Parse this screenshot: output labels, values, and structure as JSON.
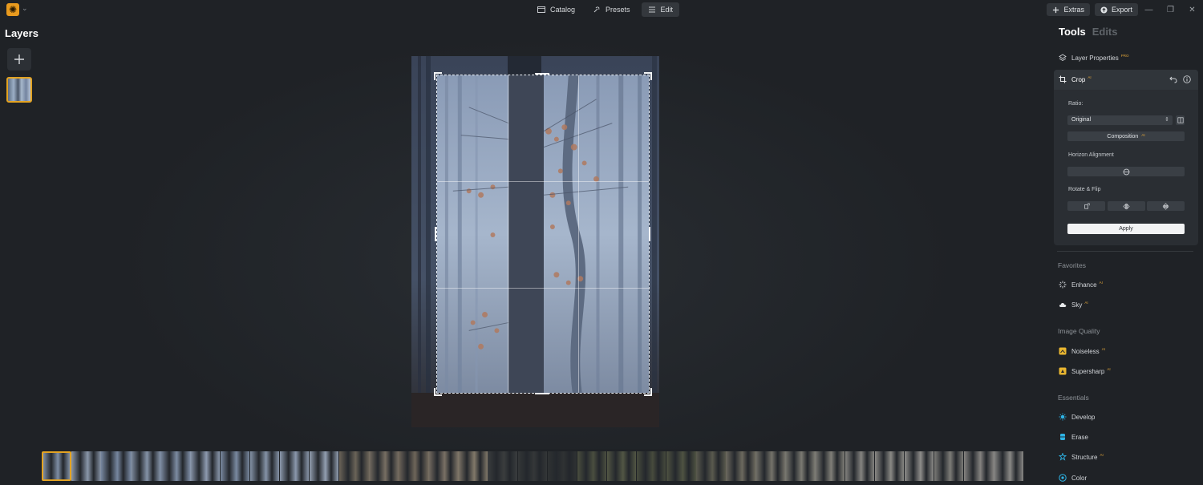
{
  "topbar": {
    "tabs": [
      {
        "label": "Catalog",
        "icon": "folder-icon"
      },
      {
        "label": "Presets",
        "icon": "sparkle-icon"
      },
      {
        "label": "Edit",
        "icon": "sliders-icon"
      }
    ],
    "extras_label": "Extras",
    "export_label": "Export",
    "minimize": "—",
    "restore": "❐",
    "close": "✕"
  },
  "layers": {
    "title": "Layers"
  },
  "panel": {
    "tabs": [
      "Tools",
      "Edits"
    ],
    "layer_properties": "Layer Properties",
    "layer_properties_badge": "PRO",
    "crop": {
      "title": "Crop",
      "badge": "AI",
      "ratio_label": "Ratio:",
      "ratio_value": "Original",
      "composition_label": "Composition",
      "composition_badge": "AI",
      "horizon_label": "Horizon Alignment",
      "rotate_label": "Rotate & Flip",
      "apply_label": "Apply"
    },
    "sections": {
      "favorites": "Favorites",
      "image_quality": "Image Quality",
      "essentials": "Essentials"
    },
    "tools": {
      "enhance": "Enhance",
      "sky": "Sky",
      "noiseless": "Noiseless",
      "supersharp": "Supersharp",
      "develop": "Develop",
      "erase": "Erase",
      "structure": "Structure",
      "color": "Color",
      "ai_badge": "AI"
    }
  },
  "colors": {
    "accent": "#e3a322",
    "background": "#1f2226",
    "panel": "#2a2e33"
  },
  "filmstrip": [
    "#7e8ea4",
    "#8a97aa",
    "#7787a0",
    "#8593a8",
    "#7d8ca3",
    "#8e9bb0",
    "#7a8aa1",
    "#8593a7",
    "#8b98ac",
    "#939fb1",
    "#6b6458",
    "#786f63",
    "#6f665a",
    "#7a7165",
    "#82796a",
    "#3a3d3e",
    "#343738",
    "#2f3233",
    "#4a4e3f",
    "#525644",
    "#474b3d",
    "#4f5342",
    "#5a5a4e",
    "#6d6a5f",
    "#75736a",
    "#7b7a72",
    "#807f78",
    "#858480",
    "#8a8985",
    "#8e8d8a",
    "#7d7c78",
    "#858380",
    "#8a8986"
  ]
}
